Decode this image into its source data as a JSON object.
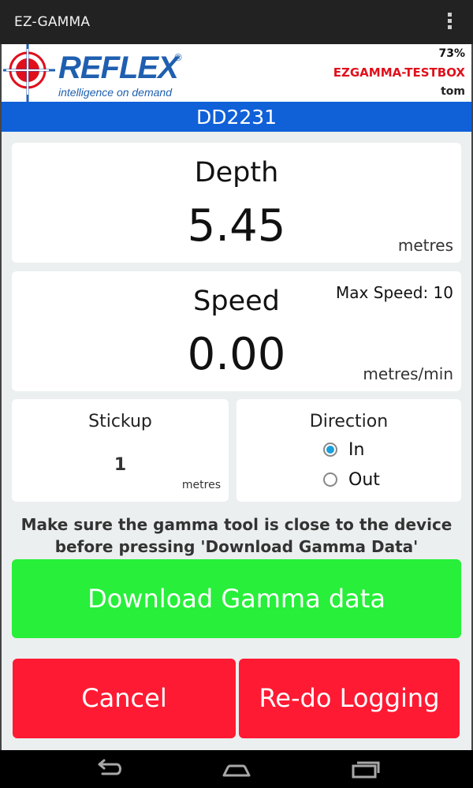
{
  "app": {
    "title": "EZ-GAMMA"
  },
  "header": {
    "logo_text": "REFLEX",
    "logo_reg": "®",
    "tagline": "intelligence on demand",
    "battery": "73%",
    "device_name": "EZGAMMA-TESTBOX",
    "user": "tom"
  },
  "hole": {
    "id": "DD2231"
  },
  "depth": {
    "label": "Depth",
    "value": "5.45",
    "unit": "metres"
  },
  "speed": {
    "label": "Speed",
    "value": "0.00",
    "unit": "metres/min",
    "max_speed": "Max Speed: 10"
  },
  "stickup": {
    "label": "Stickup",
    "value": "1",
    "unit": "metres"
  },
  "direction": {
    "label": "Direction",
    "options": [
      {
        "label": "In",
        "selected": true
      },
      {
        "label": "Out",
        "selected": false
      }
    ]
  },
  "instructions": {
    "line1": "Make sure the gamma tool is close to the device",
    "line2": "before pressing 'Download Gamma Data'"
  },
  "buttons": {
    "download": "Download Gamma data",
    "cancel": "Cancel",
    "redo": "Re-do Logging"
  },
  "icons": {
    "overflow": "overflow-menu-icon",
    "logo": "crosshair-logo-icon",
    "back": "back-icon",
    "home": "home-icon",
    "recents": "recents-icon"
  },
  "colors": {
    "brand_blue": "#1f5fb0",
    "device_red": "#e0101c",
    "banner_blue": "#1060d8",
    "download_green": "#27ef3a",
    "action_red": "#ff1a33",
    "radio_selected": "#1aa0dd"
  }
}
